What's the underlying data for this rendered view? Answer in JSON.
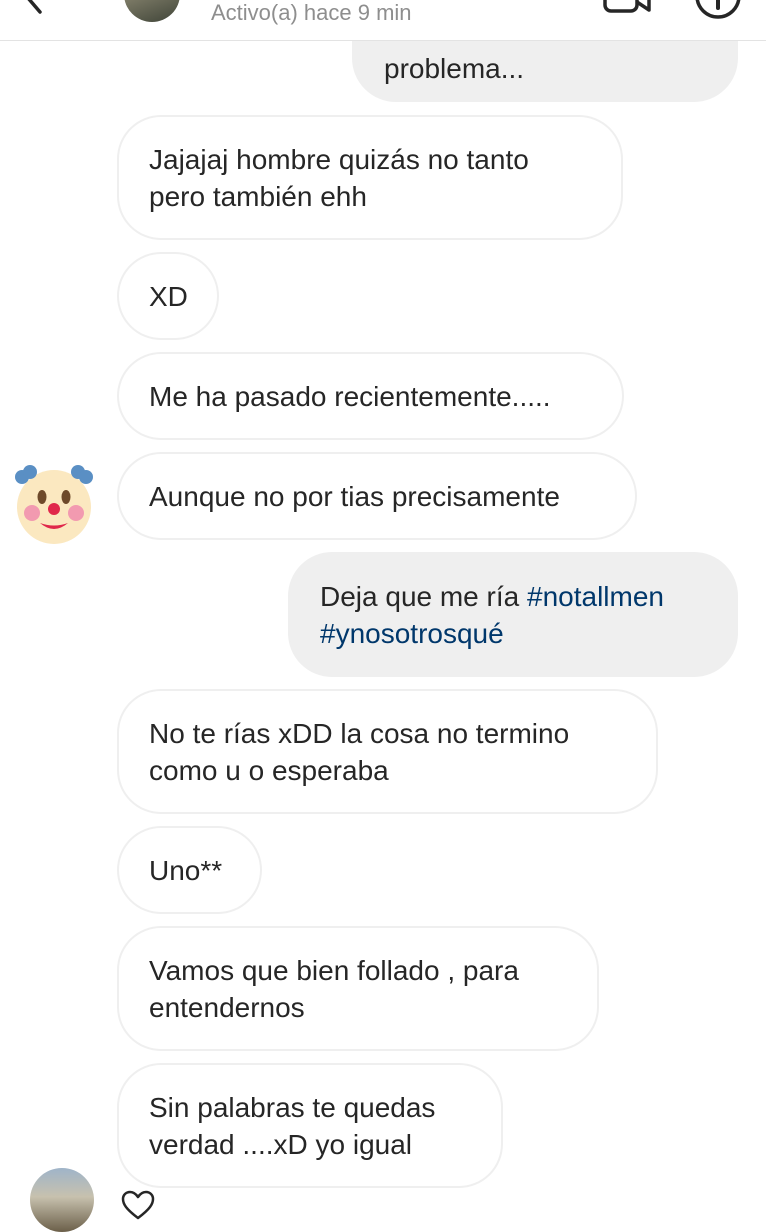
{
  "header": {
    "status": "Activo(a) hace 9 min"
  },
  "messages": [
    {
      "from": "me",
      "lines": [
        "problema..."
      ]
    },
    {
      "from": "them",
      "lines": [
        "Jajajaj  hombre quizás no tanto",
        "pero también ehh"
      ]
    },
    {
      "from": "them",
      "lines": [
        "XD"
      ]
    },
    {
      "from": "them",
      "lines": [
        "Me ha pasado recientemente....."
      ]
    },
    {
      "from": "them",
      "lines": [
        "Aunque no por tias precisamente"
      ]
    },
    {
      "from": "me",
      "lines": [
        "Deja que me ría ",
        "#notallmen",
        "#ynosotrosqué"
      ]
    },
    {
      "from": "them",
      "lines": [
        "No te rías  xDD la cosa no termino",
        "como u o esperaba"
      ]
    },
    {
      "from": "them",
      "lines": [
        "Uno**"
      ]
    },
    {
      "from": "them",
      "lines": [
        "Vamos que bien follado , para",
        "entendernos"
      ]
    },
    {
      "from": "them",
      "lines": [
        "Sin palabras te quedas",
        "verdad ....xD  yo igual"
      ]
    }
  ],
  "colors": {
    "sent_bubble": "#efefef",
    "received_border": "#efefef",
    "hashtag": "#00376b",
    "status_text": "#8e8e8e"
  },
  "icons": [
    "back-arrow-icon",
    "video-call-icon",
    "info-icon",
    "clown-face-icon",
    "heart-icon"
  ]
}
